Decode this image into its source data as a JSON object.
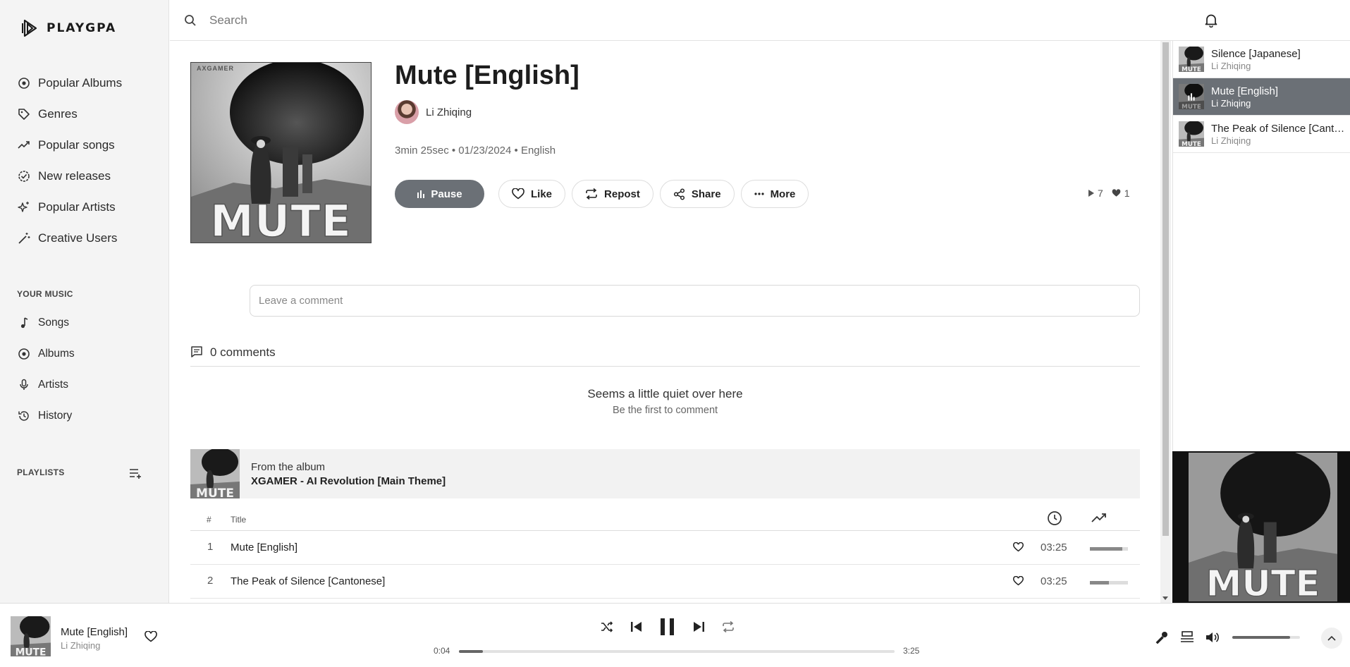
{
  "brand": {
    "name": "PLAYGPA",
    "icon": "playgpa-logo-icon"
  },
  "sidebar": {
    "main_nav": [
      {
        "label": "Popular Albums",
        "icon": "disc-icon"
      },
      {
        "label": "Genres",
        "icon": "tag-icon"
      },
      {
        "label": "Popular songs",
        "icon": "trending-up-icon"
      },
      {
        "label": "New releases",
        "icon": "badge-check-icon"
      },
      {
        "label": "Popular Artists",
        "icon": "sparkles-icon"
      },
      {
        "label": "Creative Users",
        "icon": "magic-wand-icon"
      }
    ],
    "your_music_title": "YOUR MUSIC",
    "your_music": [
      {
        "label": "Songs",
        "icon": "music-note-icon"
      },
      {
        "label": "Albums",
        "icon": "disc-icon"
      },
      {
        "label": "Artists",
        "icon": "microphone-icon"
      },
      {
        "label": "History",
        "icon": "history-icon"
      }
    ],
    "playlists_title": "PLAYLISTS"
  },
  "search": {
    "placeholder": "Search"
  },
  "song": {
    "title": "Mute [English]",
    "artist": "Li Zhiqing",
    "meta": "3min 25sec • 01/23/2024 • English",
    "cover_text": "MUTE",
    "cover_brand": "AXGAMER"
  },
  "actions": {
    "pause": "Pause",
    "like": "Like",
    "repost": "Repost",
    "share": "Share",
    "more": "More"
  },
  "stats": {
    "plays": "7",
    "likes": "1"
  },
  "comments": {
    "placeholder": "Leave a comment",
    "count_label": "0 comments",
    "empty_title": "Seems a little quiet over here",
    "empty_subtitle": "Be the first to comment"
  },
  "album": {
    "from_label": "From the album",
    "name": "XGAMER - AI Revolution [Main Theme]"
  },
  "tracklist": {
    "headers": {
      "number": "#",
      "title": "Title"
    },
    "rows": [
      {
        "number": "1",
        "title": "Mute [English]",
        "duration": "03:25",
        "popularity": 0.85
      },
      {
        "number": "2",
        "title": "The Peak of Silence [Cantonese]",
        "duration": "03:25",
        "popularity": 0.5
      }
    ]
  },
  "queue": [
    {
      "title": "Silence [Japanese]",
      "artist": "Li Zhiqing",
      "active": false
    },
    {
      "title": "Mute [English]",
      "artist": "Li Zhiqing",
      "active": true
    },
    {
      "title": "The Peak of Silence [Cantonese]",
      "artist": "Li Zhiqing",
      "active": false
    }
  ],
  "player": {
    "title": "Mute [English]",
    "artist": "Li Zhiqing",
    "elapsed": "0:04",
    "total": "3:25",
    "progress": 0.055,
    "volume": 0.85
  },
  "colors": {
    "accent": "#6b7076",
    "sidebar_bg": "#f4f4f4"
  }
}
